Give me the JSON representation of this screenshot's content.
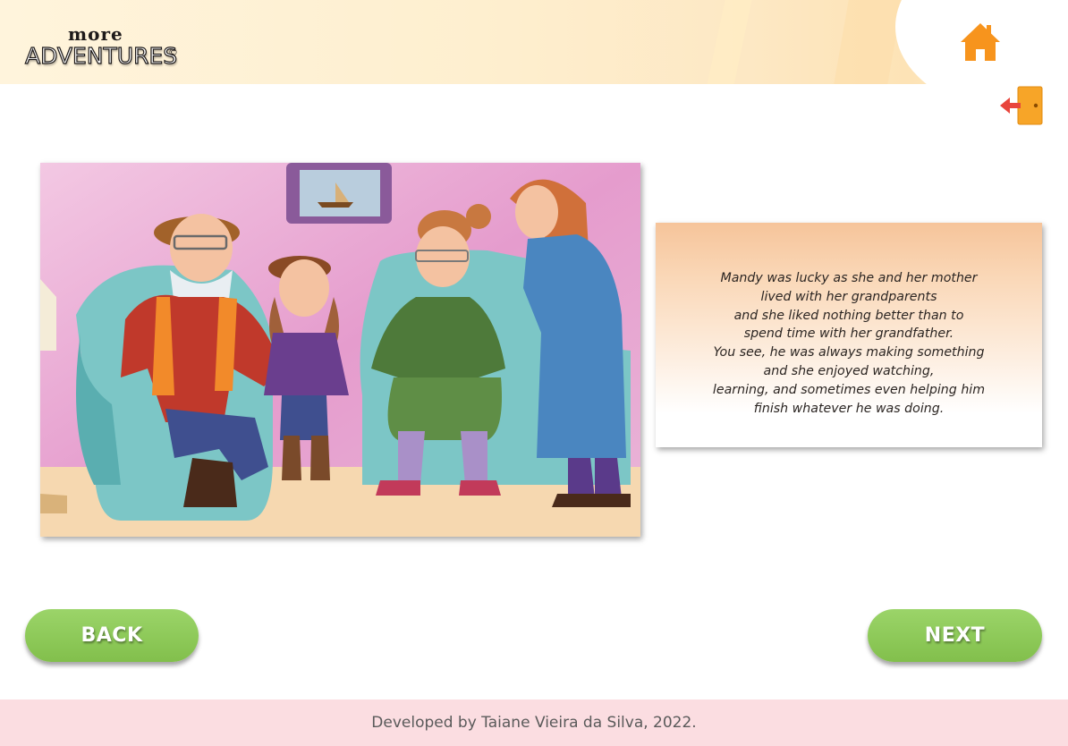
{
  "header": {
    "logo_top": "more",
    "logo_main": "ADVENTURES",
    "logo_mark": "©"
  },
  "icons": {
    "home": "home-icon",
    "exit": "exit-door-icon"
  },
  "colors": {
    "accent_orange": "#f7941d",
    "button_green": "#8cc857",
    "footer_pink": "#fbdde1",
    "header_cream": "#fef0d2"
  },
  "story": {
    "lines": [
      "Mandy was lucky as she and her mother",
      "lived with her grandparents",
      "and she liked nothing better than to",
      "spend time with her grandfather.",
      "You see, he was always making something",
      "and she enjoyed watching,",
      "learning, and sometimes even helping him",
      "finish whatever he was doing."
    ]
  },
  "nav": {
    "back_label": "BACK",
    "next_label": "NEXT"
  },
  "footer": {
    "credit": "Developed by Taiane Vieira da Silva, 2022."
  }
}
